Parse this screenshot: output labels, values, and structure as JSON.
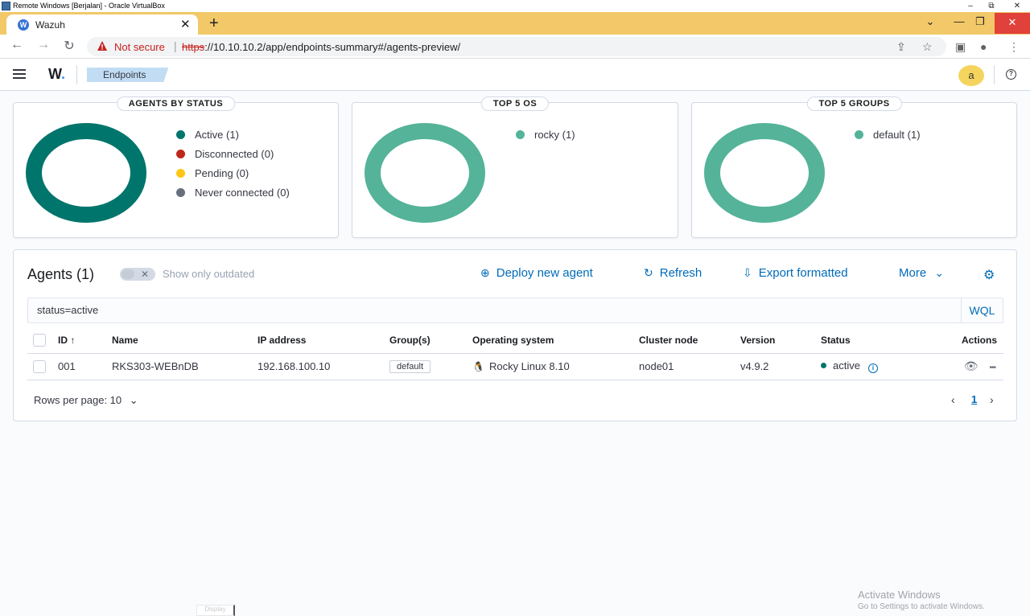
{
  "vbox": {
    "title": "Remote Windows [Berjalan] - Oracle VirtualBox",
    "min": "–",
    "restore": "⧉",
    "close": "✕"
  },
  "browser": {
    "tab_title": "Wazuh",
    "tab_favicon": "W",
    "tab_close": "✕",
    "new_tab": "+",
    "chevron": "⌄",
    "win_min": "—",
    "win_restore": "❐",
    "win_close": "✕",
    "back": "←",
    "forward": "→",
    "reload": "↻",
    "security_label": "Not secure",
    "separator": "|",
    "url_scheme": "https",
    "url_rest": "://10.10.10.2/app/endpoints-summary#/agents-preview/",
    "share": "⇪",
    "star": "☆",
    "sidepanel": "▣",
    "profile": "●",
    "menu": "⋮"
  },
  "header": {
    "logo_text": "W",
    "logo_dot": ".",
    "breadcrumb": "Endpoints",
    "avatar": "a",
    "help": "?"
  },
  "panels": [
    {
      "title": "AGENTS BY STATUS",
      "legend": [
        {
          "label": "Active (1)",
          "color": "#00756c"
        },
        {
          "label": "Disconnected (0)",
          "color": "#bd271e"
        },
        {
          "label": "Pending (0)",
          "color": "#fec514"
        },
        {
          "label": "Never connected (0)",
          "color": "#69707d"
        }
      ]
    },
    {
      "title": "TOP 5 OS",
      "legend": [
        {
          "label": "rocky (1)",
          "color": "#54b399"
        }
      ]
    },
    {
      "title": "TOP 5 GROUPS",
      "legend": [
        {
          "label": "default (1)",
          "color": "#54b399"
        }
      ]
    }
  ],
  "agents": {
    "title": "Agents (1)",
    "toggle_label": "Show only outdated",
    "toggle_x": "✕",
    "actions": {
      "deploy": "Deploy new agent",
      "deploy_icon": "⊕",
      "refresh": "Refresh",
      "refresh_icon": "↻",
      "export": "Export formatted",
      "export_icon": "⇩",
      "more": "More",
      "more_icon": "⌄",
      "settings_icon": "⚙"
    },
    "search_value": "status=active",
    "wql": "WQL",
    "columns": [
      "ID ↑",
      "Name",
      "IP address",
      "Group(s)",
      "Operating system",
      "Cluster node",
      "Version",
      "Status",
      "Actions"
    ],
    "rows": [
      {
        "id": "001",
        "name": "RKS303-WEBnDB",
        "ip": "192.168.100.10",
        "group": "default",
        "os_icon": "🐧",
        "os": "Rocky Linux 8.10",
        "node": "node01",
        "version": "v4.9.2",
        "status": "active",
        "info_icon": "i",
        "view_icon": "👁",
        "more_icon": "•••"
      }
    ],
    "rows_per_page": "Rows per page: 10",
    "rows_per_page_icon": "⌄",
    "pager_prev": "‹",
    "pager_page": "1",
    "pager_next": "›"
  },
  "watermark": {
    "line1": "Activate Windows",
    "line2": "Go to Settings to activate Windows."
  },
  "tooltip_fragment": "Display"
}
